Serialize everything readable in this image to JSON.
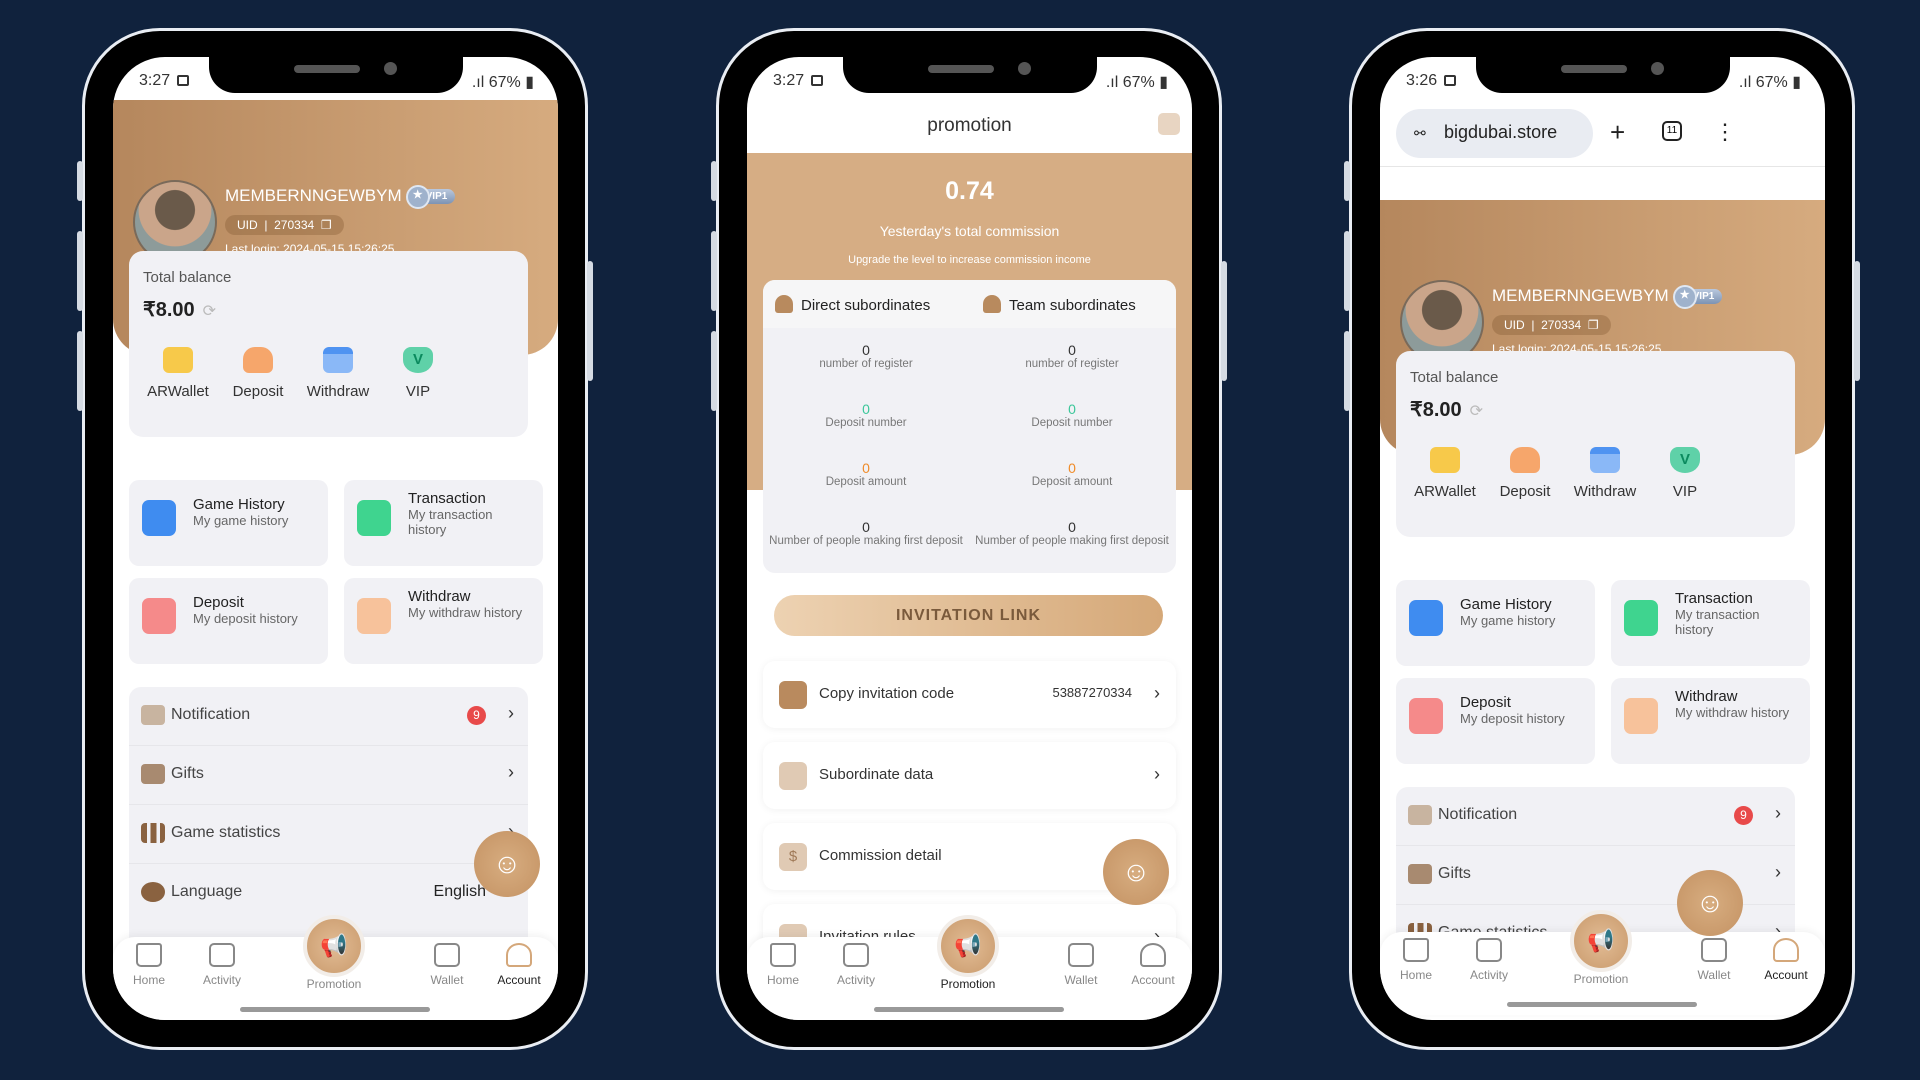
{
  "background_color": "#10223d",
  "accent_color": "#c99a6c",
  "status": {
    "time_1": "3:27",
    "time_2": "3:27",
    "time_3": "3:26",
    "battery": "67%"
  },
  "account": {
    "username": "MEMBERNNGEWBYM",
    "vip_badge": "VIP1",
    "uid_label": "UID",
    "uid": "270334",
    "last_login": "Last login: 2024-05-15 15:26:25",
    "balance_label": "Total balance",
    "balance": "₹8.00",
    "quick_actions": [
      {
        "label": "ARWallet",
        "icon": "wallet-icon"
      },
      {
        "label": "Deposit",
        "icon": "deposit-icon"
      },
      {
        "label": "Withdraw",
        "icon": "card-icon"
      },
      {
        "label": "VIP",
        "icon": "vip-icon"
      }
    ],
    "cards": [
      {
        "title": "Game History",
        "subtitle": "My game history"
      },
      {
        "title": "Transaction",
        "subtitle": "My transaction history"
      },
      {
        "title": "Deposit",
        "subtitle": "My deposit history"
      },
      {
        "title": "Withdraw",
        "subtitle": "My withdraw history"
      }
    ],
    "menu": [
      {
        "label": "Notification",
        "badge": "9"
      },
      {
        "label": "Gifts"
      },
      {
        "label": "Game statistics"
      },
      {
        "label": "Language",
        "value": "English"
      }
    ]
  },
  "promotion": {
    "title": "promotion",
    "commission": "0.74",
    "commission_label": "Yesterday's total commission",
    "upgrade_note": "Upgrade the level to increase commission income",
    "direct_label": "Direct subordinates",
    "team_label": "Team subordinates",
    "stats": [
      {
        "label": "number of register",
        "direct": "0",
        "team": "0"
      },
      {
        "label": "Deposit number",
        "direct": "0",
        "team": "0"
      },
      {
        "label": "Deposit amount",
        "direct": "0",
        "team": "0"
      },
      {
        "label": "Number of people making first deposit",
        "direct": "0",
        "team": "0"
      }
    ],
    "invitation_link": "INVITATION LINK",
    "items": [
      {
        "label": "Copy invitation code",
        "value": "53887270334"
      },
      {
        "label": "Subordinate data"
      },
      {
        "label": "Commission detail"
      },
      {
        "label": "Invitation rules"
      }
    ]
  },
  "browser": {
    "url": "bigdubai.store",
    "tab_count": "11"
  },
  "tabs": [
    "Home",
    "Activity",
    "Promotion",
    "Wallet",
    "Account"
  ]
}
